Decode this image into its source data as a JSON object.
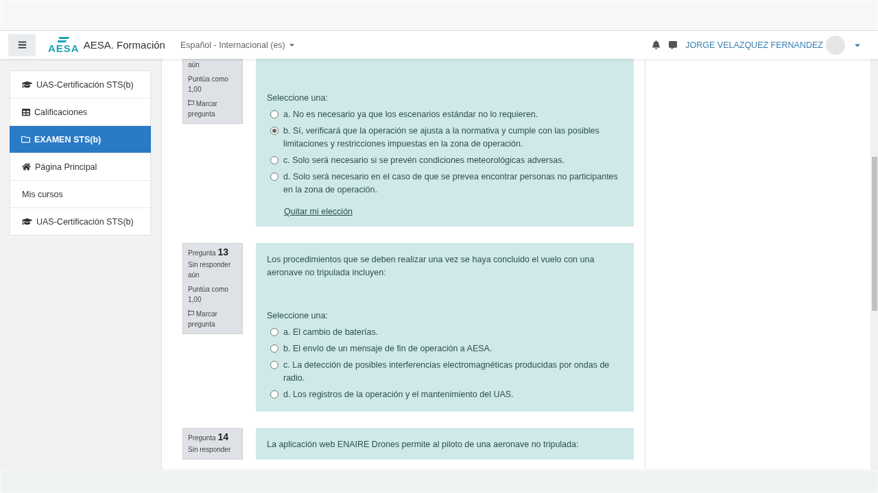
{
  "navbar": {
    "site_name": "AESA. Formación",
    "logo_text": "AESA",
    "language": "Español - Internacional (es)",
    "user_name": "JORGE VELAZQUEZ FERNANDEZ"
  },
  "sidebar": {
    "items": [
      {
        "label": "UAS-Certificación STS(b)",
        "kind": "course",
        "selected": false
      },
      {
        "label": "Calificaciones",
        "kind": "grades",
        "selected": false
      },
      {
        "label": "EXAMEN STS(b)",
        "kind": "folder",
        "selected": true
      },
      {
        "label": "Página Principal",
        "kind": "home",
        "selected": false
      },
      {
        "label": "Mis cursos",
        "kind": "plain",
        "selected": false
      },
      {
        "label": "UAS-Certificación STS(b)",
        "kind": "course",
        "selected": false
      }
    ]
  },
  "questions": [
    {
      "info": {
        "status": "aún",
        "points": "Puntúa como 1,00",
        "flag": "Marcar pregunta"
      },
      "prompt_label": "Seleccione una:",
      "options": [
        {
          "text": "a. No es necesario ya que los escenarios estándar no lo requieren.",
          "selected": false
        },
        {
          "text": "b. Sí, verificará que la operación se ajusta a la normativa y cumple con las posibles limitaciones y restricciones impuestas en la zona de operación.",
          "selected": true
        },
        {
          "text": "c. Solo será necesario si se prevén condiciones meteorológicas adversas.",
          "selected": false
        },
        {
          "text": "d. Solo será necesario en el caso de que se prevea encontrar personas no participantes en la zona de operación.",
          "selected": false
        }
      ],
      "clear_link": "Quitar mi elección"
    },
    {
      "info": {
        "label": "Pregunta",
        "number": "13",
        "status": "Sin responder aún",
        "points": "Puntúa como 1,00",
        "flag": "Marcar pregunta"
      },
      "text": "Los procedimientos que se deben realizar una vez se haya concluido el vuelo con una aeronave no tripulada incluyen:",
      "prompt_label": "Seleccione una:",
      "options": [
        {
          "text": "a. El cambio de baterías.",
          "selected": false
        },
        {
          "text": "b. El envío de un mensaje de fin de operación a AESA.",
          "selected": false
        },
        {
          "text": "c. La detección de posibles interferencias electromagnéticas producidas por ondas de radio.",
          "selected": false
        },
        {
          "text": "d. Los registros de la operación y el mantenimiento del UAS.",
          "selected": false
        }
      ]
    },
    {
      "info": {
        "label": "Pregunta",
        "number": "14",
        "status": "Sin responder"
      },
      "text": "La aplicación web ENAIRE Drones permite al piloto de una aeronave no tripulada:"
    }
  ]
}
